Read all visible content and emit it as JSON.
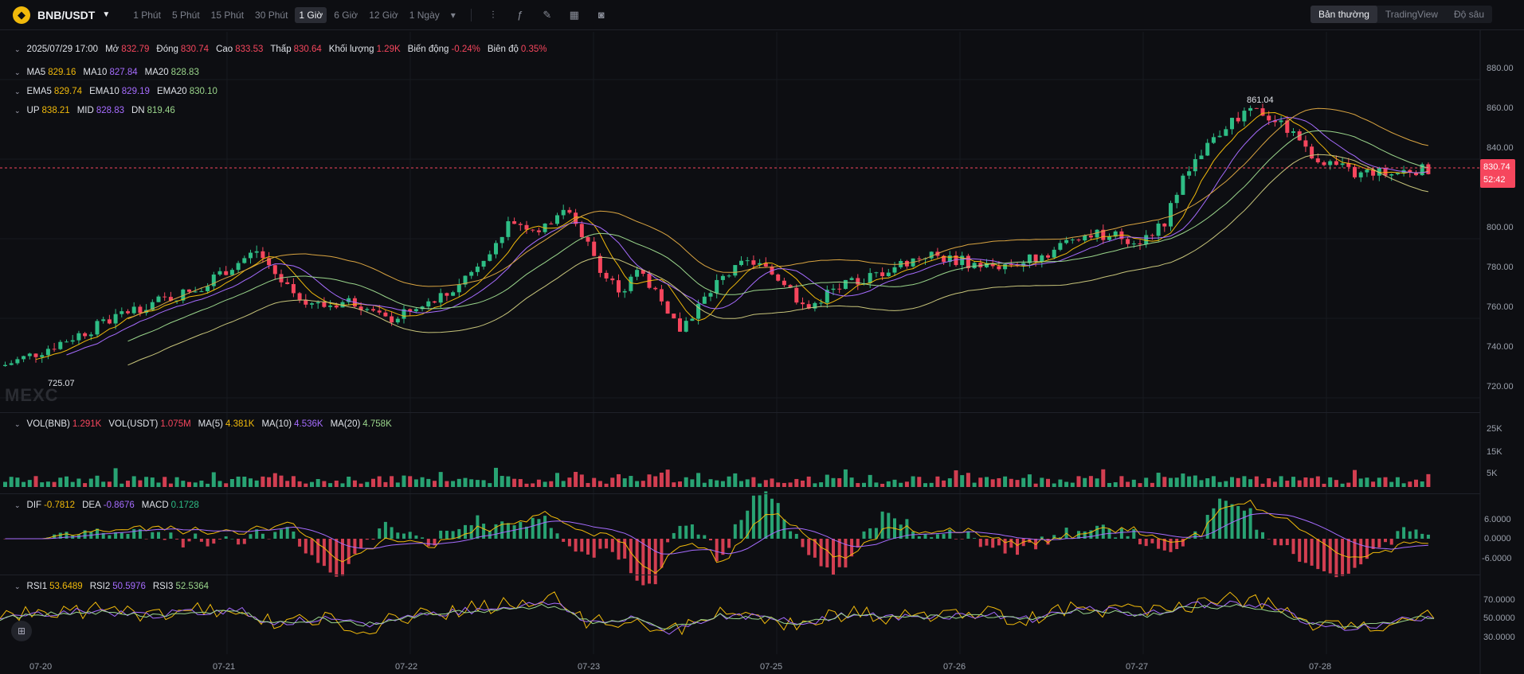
{
  "header": {
    "logo_glyph": "◆",
    "pair": "BNB/USDT",
    "intervals": [
      "1 Phút",
      "5 Phút",
      "15 Phút",
      "30 Phút",
      "1 Giờ",
      "6 Giờ",
      "12 Giờ",
      "1 Ngày"
    ],
    "active_interval": "1 Giờ",
    "tool_icons": [
      "candle-type-icon",
      "indicator-icon",
      "draw-icon",
      "layout-icon",
      "camera-icon"
    ],
    "views": [
      "Bản thường",
      "TradingView",
      "Độ sâu"
    ],
    "active_view": "Bản thường"
  },
  "ohlc": {
    "date": "2025/07/29 17:00",
    "open_label": "Mở",
    "open": "832.79",
    "close_label": "Đóng",
    "close": "830.74",
    "high_label": "Cao",
    "high": "833.53",
    "low_label": "Thấp",
    "low": "830.64",
    "volume_label": "Khối lượng",
    "volume": "1.29K",
    "change_label": "Biến động",
    "change": "-0.24%",
    "amplitude_label": "Biên độ",
    "amplitude": "0.35%"
  },
  "ma": {
    "ma5_label": "MA5",
    "ma5": "829.16",
    "ma10_label": "MA10",
    "ma10": "827.84",
    "ma20_label": "MA20",
    "ma20": "828.83"
  },
  "ema": {
    "ema5_label": "EMA5",
    "ema5": "829.74",
    "ema10_label": "EMA10",
    "ema10": "829.19",
    "ema20_label": "EMA20",
    "ema20": "830.10"
  },
  "boll": {
    "up_label": "UP",
    "up": "838.21",
    "mid_label": "MID",
    "mid": "828.83",
    "dn_label": "DN",
    "dn": "819.46"
  },
  "vol": {
    "vol_bnb_label": "VOL(BNB)",
    "vol_bnb": "1.291K",
    "vol_usdt_label": "VOL(USDT)",
    "vol_usdt": "1.075M",
    "ma5_label": "MA(5)",
    "ma5": "4.381K",
    "ma10_label": "MA(10)",
    "ma10": "4.536K",
    "ma20_label": "MA(20)",
    "ma20": "4.758K",
    "axis": [
      "25K",
      "15K",
      "5K"
    ]
  },
  "macd": {
    "dif_label": "DIF",
    "dif": "-0.7812",
    "dea_label": "DEA",
    "dea": "-0.8676",
    "macd_label": "MACD",
    "macd": "0.1728",
    "axis": [
      "6.0000",
      "0.0000",
      "-6.0000"
    ]
  },
  "rsi": {
    "rsi1_label": "RSI1",
    "rsi1": "53.6489",
    "rsi2_label": "RSI2",
    "rsi2": "50.5976",
    "rsi3_label": "RSI3",
    "rsi3": "52.5364",
    "axis": [
      "70.0000",
      "50.0000",
      "30.0000"
    ]
  },
  "price_axis": [
    "880.00",
    "860.00",
    "840.00",
    "800.00",
    "780.00",
    "760.00",
    "740.00",
    "720.00"
  ],
  "last_price": "830.74",
  "countdown": "52:42",
  "high_marker": "861.04",
  "low_marker": "725.07",
  "watermark": "MEXC",
  "x_axis": [
    "07-20",
    "07-21",
    "07-22",
    "07-23",
    "07-25",
    "07-26",
    "07-27",
    "07-28"
  ],
  "colors": {
    "up": "#2ebd85",
    "down": "#f6465d",
    "ma5": "#f0b90b",
    "ma10": "#a66cff",
    "ma20": "#9ad58b"
  },
  "chart_data": {
    "type": "candlestick",
    "price_path": [
      [
        0,
        732
      ],
      [
        40,
        738
      ],
      [
        80,
        745
      ],
      [
        120,
        752
      ],
      [
        160,
        760
      ],
      [
        200,
        765
      ],
      [
        240,
        770
      ],
      [
        280,
        780
      ],
      [
        320,
        790
      ],
      [
        360,
        770
      ],
      [
        400,
        762
      ],
      [
        440,
        765
      ],
      [
        480,
        755
      ],
      [
        520,
        760
      ],
      [
        560,
        768
      ],
      [
        600,
        785
      ],
      [
        640,
        805
      ],
      [
        680,
        800
      ],
      [
        700,
        812
      ],
      [
        720,
        805
      ],
      [
        740,
        790
      ],
      [
        760,
        775
      ],
      [
        780,
        770
      ],
      [
        800,
        780
      ],
      [
        830,
        765
      ],
      [
        850,
        750
      ],
      [
        870,
        760
      ],
      [
        900,
        775
      ],
      [
        940,
        785
      ],
      [
        980,
        775
      ],
      [
        1010,
        760
      ],
      [
        1040,
        770
      ],
      [
        1080,
        775
      ],
      [
        1120,
        782
      ],
      [
        1160,
        788
      ],
      [
        1200,
        785
      ],
      [
        1240,
        782
      ],
      [
        1280,
        784
      ],
      [
        1320,
        790
      ],
      [
        1350,
        798
      ],
      [
        1390,
        798
      ],
      [
        1430,
        795
      ],
      [
        1460,
        805
      ],
      [
        1480,
        825
      ],
      [
        1500,
        835
      ],
      [
        1520,
        845
      ],
      [
        1540,
        855
      ],
      [
        1560,
        858
      ],
      [
        1580,
        860
      ],
      [
        1600,
        855
      ],
      [
        1620,
        850
      ],
      [
        1640,
        840
      ],
      [
        1660,
        835
      ],
      [
        1680,
        832
      ],
      [
        1700,
        828
      ],
      [
        1720,
        830
      ],
      [
        1740,
        828
      ],
      [
        1770,
        831
      ],
      [
        1800,
        830
      ]
    ],
    "rsi_path": [
      [
        0,
        50
      ],
      [
        60,
        58
      ],
      [
        120,
        60
      ],
      [
        180,
        55
      ],
      [
        240,
        58
      ],
      [
        300,
        62
      ],
      [
        340,
        45
      ],
      [
        400,
        50
      ],
      [
        460,
        42
      ],
      [
        520,
        55
      ],
      [
        580,
        60
      ],
      [
        640,
        66
      ],
      [
        700,
        70
      ],
      [
        740,
        45
      ],
      [
        800,
        50
      ],
      [
        840,
        35
      ],
      [
        900,
        55
      ],
      [
        960,
        52
      ],
      [
        1000,
        44
      ],
      [
        1060,
        56
      ],
      [
        1120,
        52
      ],
      [
        1180,
        54
      ],
      [
        1240,
        55
      ],
      [
        1300,
        50
      ],
      [
        1340,
        62
      ],
      [
        1400,
        60
      ],
      [
        1440,
        55
      ],
      [
        1480,
        65
      ],
      [
        1520,
        68
      ],
      [
        1560,
        70
      ],
      [
        1600,
        64
      ],
      [
        1640,
        45
      ],
      [
        1680,
        40
      ],
      [
        1720,
        42
      ],
      [
        1760,
        48
      ],
      [
        1800,
        54
      ]
    ]
  }
}
